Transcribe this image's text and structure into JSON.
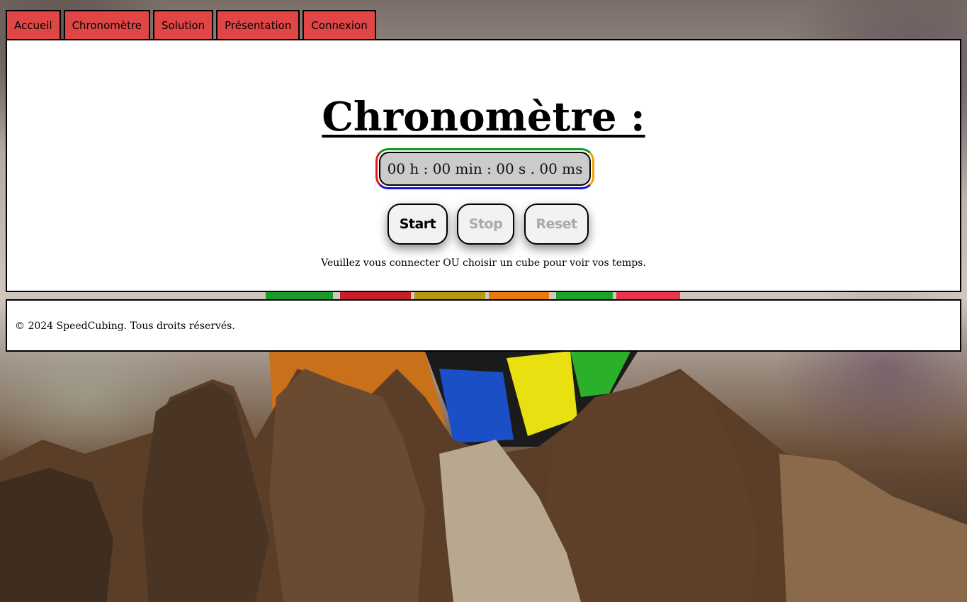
{
  "nav": {
    "items": [
      {
        "label": "Accueil"
      },
      {
        "label": "Chronomètre"
      },
      {
        "label": "Solution"
      },
      {
        "label": "Présentation"
      },
      {
        "label": "Connexion"
      }
    ]
  },
  "main": {
    "title": "Chronomètre :",
    "timer": "00 h : 00 min : 00 s . 00 ms",
    "buttons": {
      "start": "Start",
      "stop": "Stop",
      "reset": "Reset"
    },
    "message": "Veuillez vous connecter OU choisir un cube pour voir vos temps."
  },
  "footer": {
    "text": "© 2024 SpeedCubing. Tous droits réservés."
  },
  "colors": {
    "nav_bg": "#e04646",
    "timer_border_top": "#0a9a1e",
    "timer_border_left": "#e81818",
    "timer_border_right": "#f5a000",
    "timer_border_bottom": "#1414e0",
    "disabled_text": "#aaaaaa"
  }
}
